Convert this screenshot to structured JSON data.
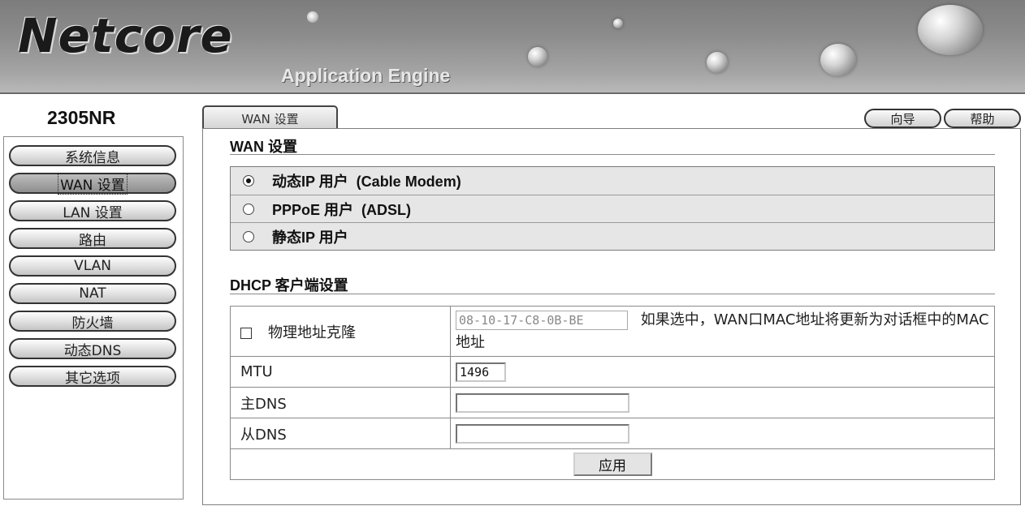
{
  "header": {
    "logo_text": "Netcore",
    "tagline": "Application Engine"
  },
  "sidebar": {
    "model": "2305NR",
    "active_index": 1,
    "items": [
      {
        "label": "系统信息"
      },
      {
        "label": "WAN 设置"
      },
      {
        "label": "LAN 设置"
      },
      {
        "label": "路由"
      },
      {
        "label": "VLAN"
      },
      {
        "label": "NAT"
      },
      {
        "label": "防火墙"
      },
      {
        "label": "动态DNS"
      },
      {
        "label": "其它选项"
      }
    ]
  },
  "toolbar": {
    "tab_label": "WAN 设置",
    "wizard_label": "向导",
    "help_label": "帮助"
  },
  "wan": {
    "section_title": "WAN 设置",
    "options": [
      {
        "label": "动态IP 用户  (Cable Modem)",
        "checked": true
      },
      {
        "label": "PPPoE 用户  (ADSL)",
        "checked": false
      },
      {
        "label": "静态IP 用户",
        "checked": false
      }
    ]
  },
  "dhcp": {
    "section_title": "DHCP 客户端设置",
    "mac_clone": {
      "label": "物理地址克隆",
      "checked": false,
      "value": "08-10-17-C8-0B-BE",
      "note": "如果选中，WAN口MAC地址将更新为对话框中的MAC地址"
    },
    "mtu": {
      "label": "MTU",
      "value": "1496"
    },
    "primary_dns": {
      "label": "主DNS",
      "value": ""
    },
    "secondary_dns": {
      "label": "从DNS",
      "value": ""
    },
    "apply_label": "应用"
  }
}
